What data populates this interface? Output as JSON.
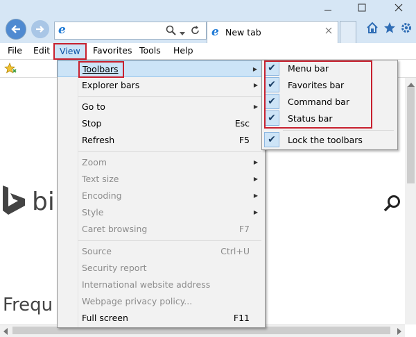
{
  "tab": {
    "title": "New tab"
  },
  "menubar": [
    {
      "label": "File",
      "id": "file"
    },
    {
      "label": "Edit",
      "id": "edit"
    },
    {
      "label": "View",
      "id": "view"
    },
    {
      "label": "Favorites",
      "id": "favorites"
    },
    {
      "label": "Tools",
      "id": "tools"
    },
    {
      "label": "Help",
      "id": "help"
    }
  ],
  "page": {
    "brand_fragment": "bi",
    "heading_fragment": "Frequ"
  },
  "view_menu": {
    "items": [
      {
        "label": "Toolbars",
        "shortcut": "",
        "submenu": true,
        "disabled": false,
        "highlight": true
      },
      {
        "label": "Explorer bars",
        "shortcut": "",
        "submenu": true,
        "disabled": false
      },
      {
        "label": "Go to",
        "shortcut": "",
        "submenu": true,
        "disabled": false
      },
      {
        "label": "Stop",
        "shortcut": "Esc",
        "submenu": false,
        "disabled": false
      },
      {
        "label": "Refresh",
        "shortcut": "F5",
        "submenu": false,
        "disabled": false
      },
      {
        "label": "Zoom",
        "shortcut": "",
        "submenu": true,
        "disabled": true
      },
      {
        "label": "Text size",
        "shortcut": "",
        "submenu": true,
        "disabled": true
      },
      {
        "label": "Encoding",
        "shortcut": "",
        "submenu": true,
        "disabled": true
      },
      {
        "label": "Style",
        "shortcut": "",
        "submenu": true,
        "disabled": true
      },
      {
        "label": "Caret browsing",
        "shortcut": "F7",
        "submenu": false,
        "disabled": true
      },
      {
        "label": "Source",
        "shortcut": "Ctrl+U",
        "submenu": false,
        "disabled": true
      },
      {
        "label": "Security report",
        "shortcut": "",
        "submenu": false,
        "disabled": true
      },
      {
        "label": "International website address",
        "shortcut": "",
        "submenu": false,
        "disabled": true
      },
      {
        "label": "Webpage privacy policy...",
        "shortcut": "",
        "submenu": false,
        "disabled": true
      },
      {
        "label": "Full screen",
        "shortcut": "F11",
        "submenu": false,
        "disabled": false
      }
    ]
  },
  "toolbars_submenu": {
    "items": [
      {
        "label": "Menu bar",
        "checked": true
      },
      {
        "label": "Favorites bar",
        "checked": true
      },
      {
        "label": "Command bar",
        "checked": true
      },
      {
        "label": "Status bar",
        "checked": true
      },
      {
        "label": "Lock the toolbars",
        "checked": true
      }
    ]
  },
  "icons": {
    "back": "back-arrow-icon",
    "forward": "forward-arrow-icon",
    "search": "search-icon",
    "refresh": "refresh-icon",
    "home": "home-icon",
    "favorites": "star-icon",
    "settings": "gear-icon",
    "check": "checkmark-icon",
    "submenu": "submenu-arrow-icon"
  },
  "colors": {
    "highlight_box": "#c8202e",
    "chrome_bg": "#d6e6f5",
    "menu_bg": "#f2f2f2",
    "selection": "#cce4f7"
  }
}
